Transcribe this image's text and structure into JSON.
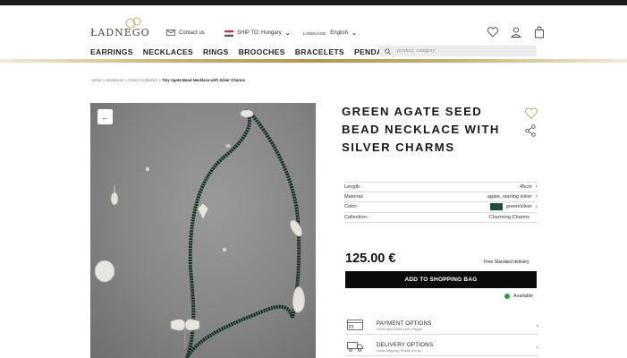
{
  "brand": {
    "logo_text": "ŁADNEGO",
    "accent_gold": "#c9ac68",
    "dark": "#0b0b0b"
  },
  "header": {
    "contact_label": "Contact us",
    "ship_label": "SHIP TO: Hungary",
    "language_prefix": "LANGUAGE:",
    "language_value": "English",
    "icons": [
      "heart-icon",
      "user-icon",
      "shopping-bag-icon"
    ]
  },
  "nav": {
    "items": [
      "EARRINGS",
      "NECKLACES",
      "RINGS",
      "BROOCHES",
      "BRACELETS",
      "PENDANTS"
    ]
  },
  "search": {
    "placeholder": "product, category"
  },
  "breadcrumb": {
    "items": [
      "Home",
      "Necklaces",
      "Charm Collection"
    ],
    "current": "Tiny Agate Bead Necklace with Silver Charms",
    "separator": " > "
  },
  "product": {
    "title": "GREEN AGATE SEED BEAD NECKLACE WITH SILVER CHARMS",
    "specs": [
      {
        "label": "Length:",
        "value": "45cm"
      },
      {
        "label": "Material:",
        "value": "agate, starling silver"
      },
      {
        "label": "Color:",
        "value": "green/silver",
        "swatch": "#1f4d3b"
      },
      {
        "label": "Collection:",
        "value": "Charming Charms"
      }
    ],
    "price": "125.00 €",
    "delivery": "Free Standard delivery",
    "add_to_bag_label": "ADD TO SHOPPING BAG",
    "availability": "Available",
    "availability_color": "#21a33a"
  },
  "options": [
    {
      "title": "PAYMENT OPTIONS",
      "subtitle": "Credit card | Debit card | Paypal",
      "icon": "credit-card-icon"
    },
    {
      "title": "DELIVERY OPTIONS",
      "subtitle": "Home shipping | Pickup at a ller",
      "icon": "delivery-truck-icon"
    }
  ]
}
